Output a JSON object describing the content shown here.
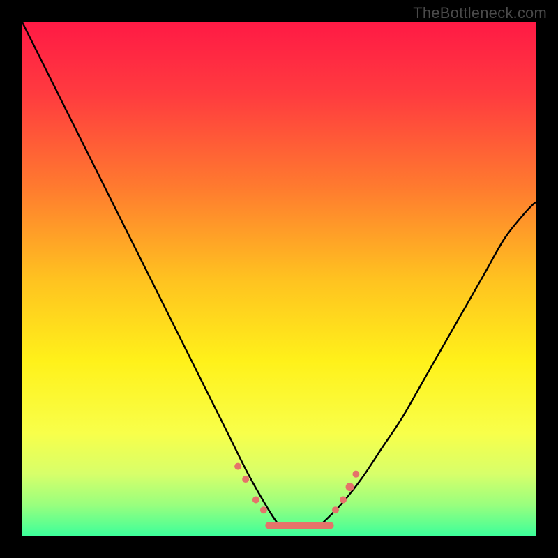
{
  "watermark": "TheBottleneck.com",
  "chart_data": {
    "type": "line",
    "title": "",
    "xlabel": "",
    "ylabel": "",
    "xlim": [
      0,
      100
    ],
    "ylim": [
      0,
      100
    ],
    "gradient_stops": [
      {
        "pct": 0,
        "color": "#ff1a45"
      },
      {
        "pct": 14,
        "color": "#ff3b3f"
      },
      {
        "pct": 32,
        "color": "#ff7a2f"
      },
      {
        "pct": 50,
        "color": "#ffc220"
      },
      {
        "pct": 66,
        "color": "#fff11a"
      },
      {
        "pct": 80,
        "color": "#f8ff4a"
      },
      {
        "pct": 88,
        "color": "#d7ff6a"
      },
      {
        "pct": 94,
        "color": "#99ff7e"
      },
      {
        "pct": 100,
        "color": "#3dff9a"
      }
    ],
    "series": [
      {
        "name": "left-curve",
        "x": [
          0,
          4,
          8,
          12,
          16,
          20,
          24,
          28,
          32,
          36,
          40,
          44,
          48,
          50
        ],
        "y": [
          100,
          92,
          84,
          76,
          68,
          60,
          52,
          44,
          36,
          28,
          20,
          12,
          5,
          2
        ]
      },
      {
        "name": "right-curve",
        "x": [
          58,
          62,
          66,
          70,
          74,
          78,
          82,
          86,
          90,
          94,
          98,
          100
        ],
        "y": [
          2,
          6,
          11,
          17,
          23,
          30,
          37,
          44,
          51,
          58,
          63,
          65
        ]
      }
    ],
    "flat_bottom": {
      "x_start": 48,
      "x_end": 60,
      "y": 2
    },
    "beads": [
      {
        "x": 42.0,
        "y": 13.5,
        "r": 5
      },
      {
        "x": 43.5,
        "y": 11.0,
        "r": 5
      },
      {
        "x": 45.5,
        "y": 7.0,
        "r": 5
      },
      {
        "x": 47.0,
        "y": 5.0,
        "r": 5
      },
      {
        "x": 61.0,
        "y": 5.0,
        "r": 5
      },
      {
        "x": 62.5,
        "y": 7.0,
        "r": 5
      },
      {
        "x": 63.8,
        "y": 9.5,
        "r": 6
      },
      {
        "x": 65.0,
        "y": 12.0,
        "r": 5
      }
    ]
  }
}
